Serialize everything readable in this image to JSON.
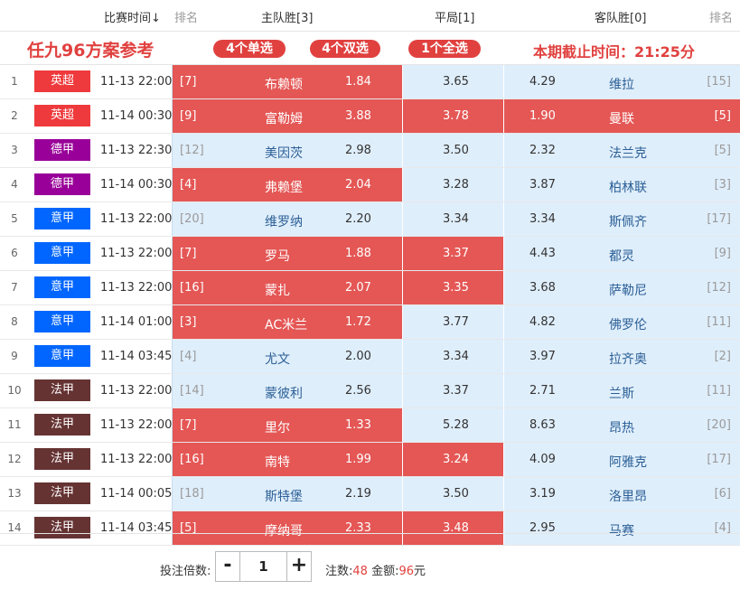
{
  "header": {
    "time_label": "比赛时间↓",
    "rank_label": "排名",
    "home_label": "主队胜[3]",
    "draw_label": "平局[1]",
    "away_label": "客队胜[0]",
    "rank_label_right": "排名"
  },
  "banner": {
    "title": "任九96方案参考",
    "pill_single": "4个单选",
    "pill_double": "4个双选",
    "pill_all": "1个全选",
    "deadline": "本期截止时间：21:25分"
  },
  "colors": {
    "selected": "#e45755",
    "unselected": "#dfeefb",
    "accent": "#e0413f",
    "league_premier": "#ee3a3c",
    "league_bundesliga": "#990099",
    "league_serie_a": "#0066ff",
    "league_ligue1": "#663333"
  },
  "matches": [
    {
      "idx": "1",
      "league": "英超",
      "league_color": "#ee3a3c",
      "time": "11-13 22:00",
      "home_rank": "[7]",
      "home": "布赖顿",
      "home_odds": "1.84",
      "draw_odds": "3.65",
      "away_odds": "4.29",
      "away": "维拉",
      "away_rank": "[15]",
      "sel": [
        true,
        false,
        false
      ]
    },
    {
      "idx": "2",
      "league": "英超",
      "league_color": "#ee3a3c",
      "time": "11-14 00:30",
      "home_rank": "[9]",
      "home": "富勒姆",
      "home_odds": "3.88",
      "draw_odds": "3.78",
      "away_odds": "1.90",
      "away": "曼联",
      "away_rank": "[5]",
      "sel": [
        true,
        true,
        true
      ]
    },
    {
      "idx": "3",
      "league": "德甲",
      "league_color": "#990099",
      "time": "11-13 22:30",
      "home_rank": "[12]",
      "home": "美因茨",
      "home_odds": "2.98",
      "draw_odds": "3.50",
      "away_odds": "2.32",
      "away": "法兰克",
      "away_rank": "[5]",
      "sel": [
        false,
        false,
        false
      ]
    },
    {
      "idx": "4",
      "league": "德甲",
      "league_color": "#990099",
      "time": "11-14 00:30",
      "home_rank": "[4]",
      "home": "弗赖堡",
      "home_odds": "2.04",
      "draw_odds": "3.28",
      "away_odds": "3.87",
      "away": "柏林联",
      "away_rank": "[3]",
      "sel": [
        true,
        false,
        false
      ]
    },
    {
      "idx": "5",
      "league": "意甲",
      "league_color": "#0066ff",
      "time": "11-13 22:00",
      "home_rank": "[20]",
      "home": "维罗纳",
      "home_odds": "2.20",
      "draw_odds": "3.34",
      "away_odds": "3.34",
      "away": "斯佩齐",
      "away_rank": "[17]",
      "sel": [
        false,
        false,
        false
      ]
    },
    {
      "idx": "6",
      "league": "意甲",
      "league_color": "#0066ff",
      "time": "11-13 22:00",
      "home_rank": "[7]",
      "home": "罗马",
      "home_odds": "1.88",
      "draw_odds": "3.37",
      "away_odds": "4.43",
      "away": "都灵",
      "away_rank": "[9]",
      "sel": [
        true,
        true,
        false
      ]
    },
    {
      "idx": "7",
      "league": "意甲",
      "league_color": "#0066ff",
      "time": "11-13 22:00",
      "home_rank": "[16]",
      "home": "蒙扎",
      "home_odds": "2.07",
      "draw_odds": "3.35",
      "away_odds": "3.68",
      "away": "萨勒尼",
      "away_rank": "[12]",
      "sel": [
        true,
        true,
        false
      ]
    },
    {
      "idx": "8",
      "league": "意甲",
      "league_color": "#0066ff",
      "time": "11-14 01:00",
      "home_rank": "[3]",
      "home": "AC米兰",
      "home_odds": "1.72",
      "draw_odds": "3.77",
      "away_odds": "4.82",
      "away": "佛罗伦",
      "away_rank": "[11]",
      "sel": [
        true,
        false,
        false
      ]
    },
    {
      "idx": "9",
      "league": "意甲",
      "league_color": "#0066ff",
      "time": "11-14 03:45",
      "home_rank": "[4]",
      "home": "尤文",
      "home_odds": "2.00",
      "draw_odds": "3.34",
      "away_odds": "3.97",
      "away": "拉齐奥",
      "away_rank": "[2]",
      "sel": [
        false,
        false,
        false
      ]
    },
    {
      "idx": "10",
      "league": "法甲",
      "league_color": "#663333",
      "time": "11-13 22:00",
      "home_rank": "[14]",
      "home": "蒙彼利",
      "home_odds": "2.56",
      "draw_odds": "3.37",
      "away_odds": "2.71",
      "away": "兰斯",
      "away_rank": "[11]",
      "sel": [
        false,
        false,
        false
      ]
    },
    {
      "idx": "11",
      "league": "法甲",
      "league_color": "#663333",
      "time": "11-13 22:00",
      "home_rank": "[7]",
      "home": "里尔",
      "home_odds": "1.33",
      "draw_odds": "5.28",
      "away_odds": "8.63",
      "away": "昂热",
      "away_rank": "[20]",
      "sel": [
        true,
        false,
        false
      ]
    },
    {
      "idx": "12",
      "league": "法甲",
      "league_color": "#663333",
      "time": "11-13 22:00",
      "home_rank": "[16]",
      "home": "南特",
      "home_odds": "1.99",
      "draw_odds": "3.24",
      "away_odds": "4.09",
      "away": "阿雅克",
      "away_rank": "[17]",
      "sel": [
        true,
        true,
        false
      ]
    },
    {
      "idx": "13",
      "league": "法甲",
      "league_color": "#663333",
      "time": "11-14 00:05",
      "home_rank": "[18]",
      "home": "斯特堡",
      "home_odds": "2.19",
      "draw_odds": "3.50",
      "away_odds": "3.19",
      "away": "洛里昂",
      "away_rank": "[6]",
      "sel": [
        false,
        false,
        false
      ]
    },
    {
      "idx": "14",
      "league": "法甲",
      "league_color": "#663333",
      "time": "11-14 03:45",
      "home_rank": "[5]",
      "home": "摩纳哥",
      "home_odds": "2.33",
      "draw_odds": "3.48",
      "away_odds": "2.95",
      "away": "马赛",
      "away_rank": "[4]",
      "sel": [
        true,
        true,
        false
      ]
    }
  ],
  "footer": {
    "multiplier_label": "投注倍数:",
    "minus": "-",
    "plus": "+",
    "multiplier_value": "1",
    "bets_label": "注数:",
    "bets_value": "48",
    "amount_label": "金额:",
    "amount_value": "96",
    "amount_unit": "元"
  }
}
